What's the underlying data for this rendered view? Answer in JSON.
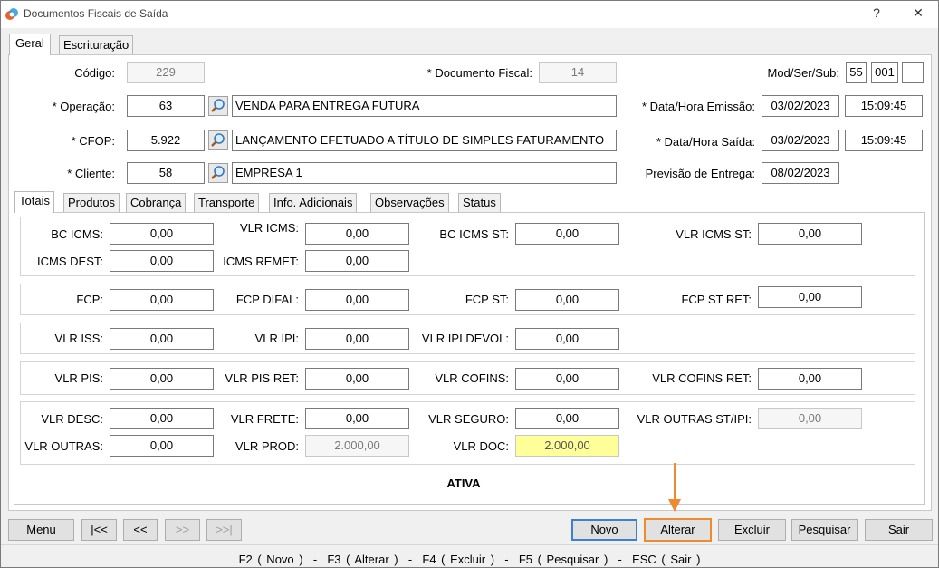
{
  "window": {
    "title": "Documentos Fiscais de Saída",
    "help": "?",
    "close": "✕"
  },
  "main_tabs": [
    "Geral",
    "Escrituração"
  ],
  "header": {
    "codigo_label": "Código:",
    "codigo_value": "229",
    "doc_fiscal_label": "* Documento Fiscal:",
    "doc_fiscal_value": "14",
    "modsersub_label": "Mod/Ser/Sub:",
    "mod_value": "55",
    "ser_value": "001",
    "sub_value": "",
    "operacao_label": "* Operação:",
    "operacao_code": "63",
    "operacao_desc": "VENDA PARA ENTREGA FUTURA",
    "cfop_label": "* CFOP:",
    "cfop_code": "5.922",
    "cfop_desc": "LANÇAMENTO EFETUADO A TÍTULO DE SIMPLES FATURAMENTO",
    "cliente_label": "* Cliente:",
    "cliente_code": "58",
    "cliente_desc": "EMPRESA 1",
    "emissao_label": "* Data/Hora Emissão:",
    "emissao_date": "03/02/2023",
    "emissao_time": "15:09:45",
    "saida_label": "* Data/Hora Saída:",
    "saida_date": "03/02/2023",
    "saida_time": "15:09:45",
    "previsao_label": "Previsão de Entrega:",
    "previsao_date": "08/02/2023"
  },
  "sub_tabs": [
    "Totais",
    "Produtos",
    "Cobrança",
    "Transporte",
    "Info. Adicionais",
    "Observações",
    "Status"
  ],
  "totais": {
    "bc_icms_label": "BC ICMS:",
    "bc_icms": "0,00",
    "vlr_icms_label": "VLR ICMS:",
    "vlr_icms": "0,00",
    "bc_icms_st_label": "BC ICMS ST:",
    "bc_icms_st": "0,00",
    "vlr_icms_st_label": "VLR ICMS ST:",
    "vlr_icms_st": "0,00",
    "icms_dest_label": "ICMS DEST:",
    "icms_dest": "0,00",
    "icms_remet_label": "ICMS REMET:",
    "icms_remet": "0,00",
    "fcp_label": "FCP:",
    "fcp": "0,00",
    "fcp_difal_label": "FCP DIFAL:",
    "fcp_difal": "0,00",
    "fcp_st_label": "FCP ST:",
    "fcp_st": "0,00",
    "fcp_st_ret_label": "FCP ST RET:",
    "fcp_st_ret": "0,00",
    "vlr_iss_label": "VLR ISS:",
    "vlr_iss": "0,00",
    "vlr_ipi_label": "VLR IPI:",
    "vlr_ipi": "0,00",
    "vlr_ipi_devol_label": "VLR IPI DEVOL:",
    "vlr_ipi_devol": "0,00",
    "vlr_pis_label": "VLR PIS:",
    "vlr_pis": "0,00",
    "vlr_pis_ret_label": "VLR PIS RET:",
    "vlr_pis_ret": "0,00",
    "vlr_cofins_label": "VLR COFINS:",
    "vlr_cofins": "0,00",
    "vlr_cofins_ret_label": "VLR COFINS RET:",
    "vlr_cofins_ret": "0,00",
    "vlr_desc_label": "VLR DESC:",
    "vlr_desc": "0,00",
    "vlr_frete_label": "VLR FRETE:",
    "vlr_frete": "0,00",
    "vlr_seguro_label": "VLR SEGURO:",
    "vlr_seguro": "0,00",
    "vlr_outras_st_ipi_label": "VLR OUTRAS ST/IPI:",
    "vlr_outras_st_ipi": "0,00",
    "vlr_outras_label": "VLR OUTRAS:",
    "vlr_outras": "0,00",
    "vlr_prod_label": "VLR PROD:",
    "vlr_prod": "2.000,00",
    "vlr_doc_label": "VLR DOC:",
    "vlr_doc": "2.000,00"
  },
  "status_text": "ATIVA",
  "buttons": {
    "menu": "Menu",
    "first": "|<<",
    "prev": "<<",
    "next": ">>",
    "last": ">>|",
    "novo": "Novo",
    "alterar": "Alterar",
    "excluir": "Excluir",
    "pesquisar": "Pesquisar",
    "sair": "Sair"
  },
  "shortcuts": "F2 ( Novo )  -  F3 ( Alterar )  -  F4 ( Excluir )  -  F5 ( Pesquisar )  -  ESC ( Sair )",
  "colors": {
    "highlight_arrow": "#f08a30",
    "primary_border": "#3c80d0",
    "vlr_doc_bg": "#ffff99"
  },
  "icons": {
    "lookup": "magnifier-icon",
    "app": "app-logo-icon"
  }
}
